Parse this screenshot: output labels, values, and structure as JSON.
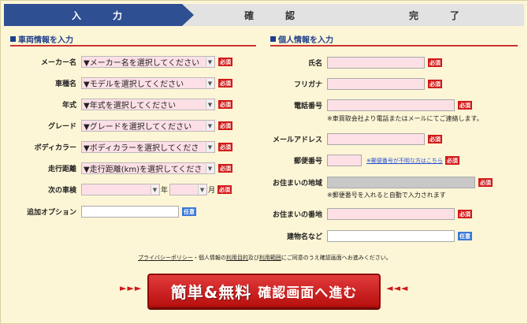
{
  "steps": [
    "入　力",
    "確　認",
    "完　了"
  ],
  "vehicle": {
    "title": "車両情報を入力",
    "maker": {
      "label": "メーカー名",
      "value": "▼メーカー名を選択してください"
    },
    "model": {
      "label": "車種名",
      "value": "▼モデルを選択してください"
    },
    "year": {
      "label": "年式",
      "value": "▼年式を選択してください"
    },
    "grade": {
      "label": "グレード",
      "value": "▼グレードを選択してください"
    },
    "color": {
      "label": "ボディカラー",
      "value": "▼ボディカラーを選択してくださ"
    },
    "mileage": {
      "label": "走行距離",
      "value": "▼走行距離(km)を選択してくださ"
    },
    "inspection": {
      "label": "次の車検",
      "year_unit": "年",
      "month_unit": "月"
    },
    "option": {
      "label": "追加オプション"
    }
  },
  "personal": {
    "title": "個人情報を入力",
    "name": {
      "label": "氏名"
    },
    "kana": {
      "label": "フリガナ"
    },
    "phone": {
      "label": "電話番号",
      "note": "※車買取会社より電話またはメールにてご連絡します。"
    },
    "email": {
      "label": "メールアドレス"
    },
    "zip": {
      "label": "郵便番号",
      "link": "※郵便番号が不明な方はこちら"
    },
    "area": {
      "label": "お住まいの地域",
      "note": "※郵便番号を入れると自動で入力されます"
    },
    "address": {
      "label": "お住まいの番地"
    },
    "building": {
      "label": "建物名など"
    }
  },
  "badges": {
    "required": "必須",
    "optional": "任意"
  },
  "privacy": {
    "link1": "プライバシーポリシー",
    "mid1": "・個人情報の",
    "link2": "利用目的",
    "mid2": "及び",
    "link3": "利用範囲",
    "tail": "にご同意のうえ確認画面へお進みください。"
  },
  "cta": {
    "big": "簡単&無料",
    "rest": "確認画面へ進む",
    "left_arrows": "►►►",
    "right_arrows": "◄◄◄"
  },
  "colors": {
    "accent": "#2f4f93",
    "required": "#d21a1a",
    "optional": "#3b78d8",
    "field_bg": "#fde0e6",
    "cta": "#c41818"
  }
}
